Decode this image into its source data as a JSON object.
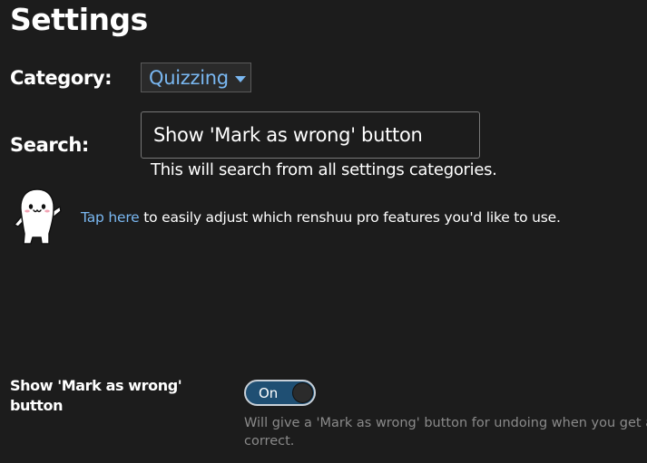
{
  "page": {
    "title": "Settings"
  },
  "category": {
    "label": "Category:",
    "selected": "Quizzing"
  },
  "search": {
    "label": "Search:",
    "value": "Show 'Mark as wrong' button",
    "hint": "This will search from all settings categories."
  },
  "pro": {
    "link_text": "Tap here",
    "rest_text": " to easily adjust which renshuu pro features you'd like to use.",
    "mascot_icon": "mascot-icon"
  },
  "setting": {
    "name": "Show 'Mark as wrong' button",
    "toggle_label": "On",
    "toggle_on": true,
    "description_line1": "Will give a 'Mark as wrong' button for undoing when you get a c",
    "description_line2": "correct."
  },
  "colors": {
    "background": "#1c1c1c",
    "accent": "#7ab8f2",
    "toggle_on": "#1f4f73",
    "muted_text": "#8a8a8a"
  }
}
